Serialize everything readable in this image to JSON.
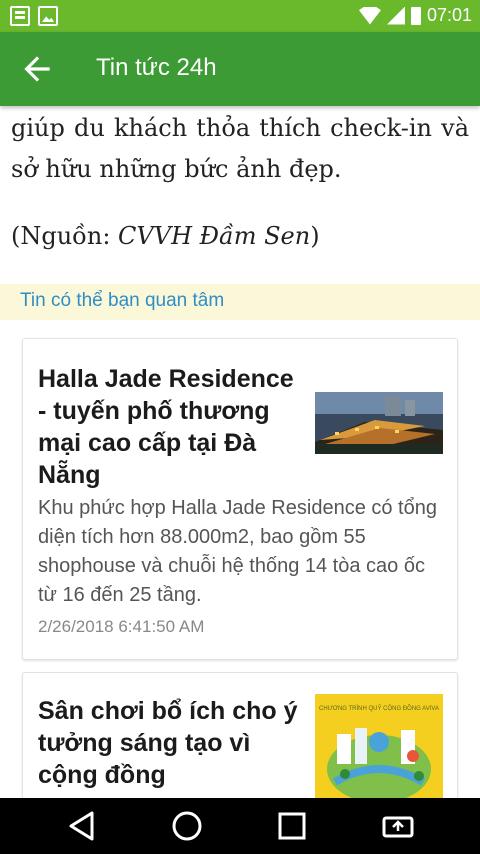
{
  "status_bar": {
    "time": "07:01",
    "left_icons": [
      "multi-window-icon",
      "image-icon"
    ],
    "right_icons": [
      "wifi-icon",
      "signal-icon",
      "battery-icon"
    ]
  },
  "app_bar": {
    "title": "Tin tức 24h",
    "back_icon": "arrow-left-icon",
    "background": "#3d9b35"
  },
  "article": {
    "tail_text": "giúp du khách thỏa thích check-in và sở hữu những bức ảnh đẹp.",
    "source_prefix": "(Nguồn: ",
    "source_name": "CVVH Đầm Sen",
    "source_suffix": ")"
  },
  "related": {
    "header": "Tin có thể bạn quan tâm",
    "items": [
      {
        "title": "Halla Jade Residence - tuyến phố thương mại cao cấp tại Đà Nẵng",
        "description": "Khu phức hợp Halla Jade Residence có tổng diện tích hơn 88.000m2, bao gồm 55 shophouse và chuỗi hệ thống 14 tòa cao ốc từ 16 đến 25 tầng.",
        "date": "2/26/2018 6:41:50 AM"
      },
      {
        "title": "Sân chơi bổ ích cho ý tưởng sáng tạo vì cộng đồng",
        "thumb_caption": "CHƯƠNG TRÌNH QUỸ CỘNG ĐỒNG AVIVA"
      }
    ]
  },
  "nav_bar": {
    "buttons": [
      "back-triangle-icon",
      "home-circle-icon",
      "recents-square-icon",
      "rotate-screen-icon"
    ]
  },
  "colors": {
    "status_bar": "#6ab92d",
    "app_bar": "#3d9b35",
    "related_header_bg": "#fbf8d9",
    "related_header_text": "#2f8ec6"
  }
}
